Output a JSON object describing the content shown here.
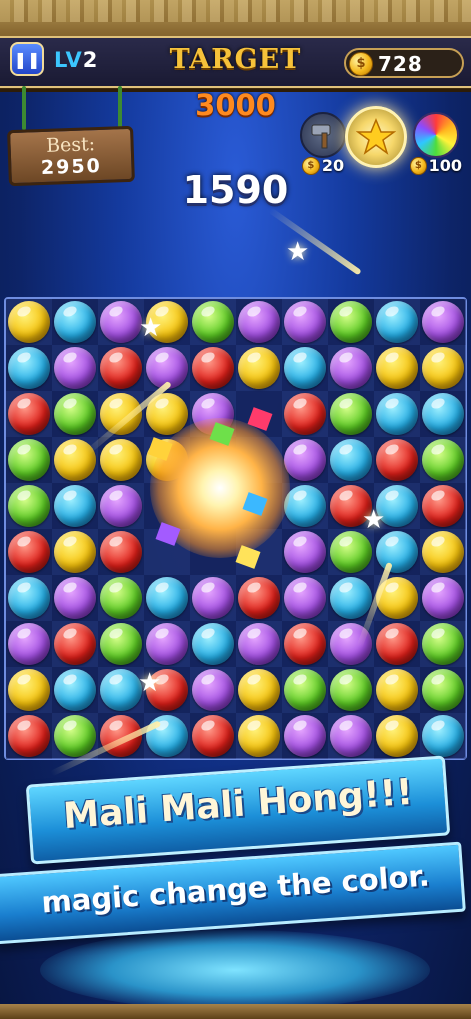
{
  "hud": {
    "pause_icon": "pause-icon",
    "level_prefix": "LV",
    "level_number": "2",
    "target_label": "TARGET",
    "target_value": "3000",
    "coins": "728",
    "best_label": "Best:",
    "best_value": "2950",
    "score": "1590"
  },
  "boosters": [
    {
      "name": "hammer",
      "icon": "hammer-icon",
      "cost": "20"
    },
    {
      "name": "star-wand",
      "icon": "star-wand-icon",
      "cost": ""
    },
    {
      "name": "rainbow-ball",
      "icon": "rainbow-ball-icon",
      "cost": "100"
    }
  ],
  "board": {
    "rows": 10,
    "cols": 10,
    "colors": {
      "Y": "#f5c20c",
      "B": "#25aee6",
      "P": "#a24fe2",
      "G": "#5ccb24",
      "R": "#e0201a"
    },
    "grid": [
      [
        "Y",
        "B",
        "P",
        "Y",
        "G",
        "P",
        "P",
        "G",
        "B",
        "P"
      ],
      [
        "B",
        "P",
        "R",
        "P",
        "R",
        "Y",
        "B",
        "P",
        "Y",
        "Y"
      ],
      [
        "R",
        "G",
        "Y",
        "Y",
        "P",
        "",
        "R",
        "G",
        "B",
        "B"
      ],
      [
        "G",
        "Y",
        "Y",
        "Y",
        "",
        "",
        "P",
        "B",
        "R",
        "G"
      ],
      [
        "G",
        "B",
        "P",
        "",
        "",
        "",
        "B",
        "R",
        "B",
        "R"
      ],
      [
        "R",
        "Y",
        "R",
        "",
        "",
        "",
        "P",
        "G",
        "B",
        "Y"
      ],
      [
        "B",
        "P",
        "G",
        "B",
        "P",
        "R",
        "P",
        "B",
        "Y",
        "P"
      ],
      [
        "P",
        "R",
        "G",
        "P",
        "B",
        "P",
        "R",
        "P",
        "R",
        "G"
      ],
      [
        "Y",
        "B",
        "B",
        "R",
        "P",
        "Y",
        "G",
        "G",
        "Y",
        "G"
      ],
      [
        "R",
        "G",
        "R",
        "B",
        "R",
        "Y",
        "P",
        "P",
        "Y",
        "B"
      ]
    ]
  },
  "banners": {
    "line1": "Mali Mali Hong!!!",
    "line2": "magic change the color."
  }
}
